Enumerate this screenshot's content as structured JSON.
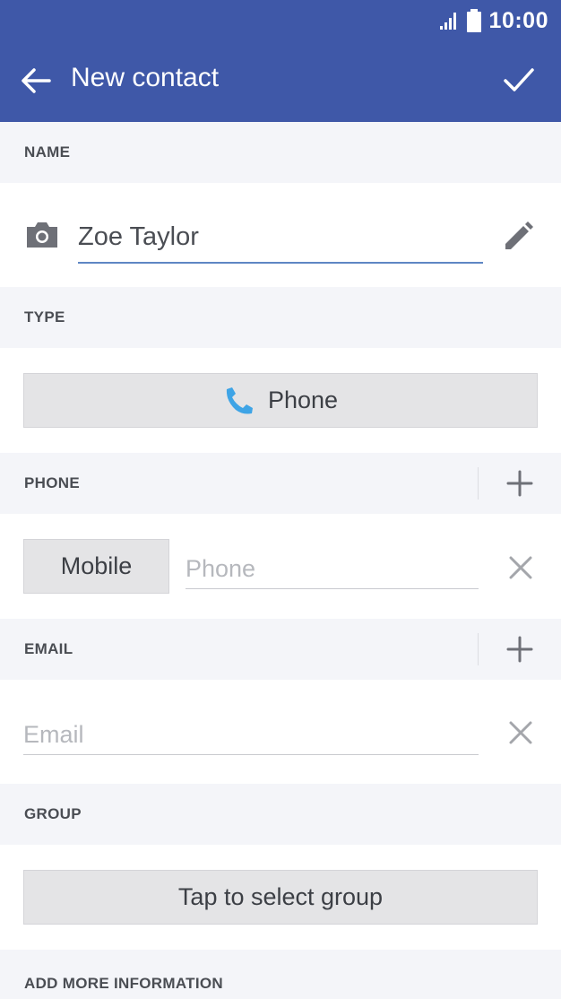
{
  "status_bar": {
    "time": "10:00"
  },
  "app_bar": {
    "title": "New contact"
  },
  "sections": {
    "name": {
      "label": "NAME",
      "value": "Zoe Taylor"
    },
    "type": {
      "label": "TYPE",
      "button_label": "Phone"
    },
    "phone": {
      "label": "PHONE",
      "type_label": "Mobile",
      "placeholder": "Phone"
    },
    "email": {
      "label": "EMAIL",
      "placeholder": "Email"
    },
    "group": {
      "label": "GROUP",
      "button_label": "Tap to select group"
    },
    "more": {
      "label": "ADD MORE INFORMATION"
    }
  },
  "colors": {
    "app_bar": "#3f58a8",
    "field_underline": "#5f86c4",
    "phone_icon": "#3ea4e6"
  }
}
